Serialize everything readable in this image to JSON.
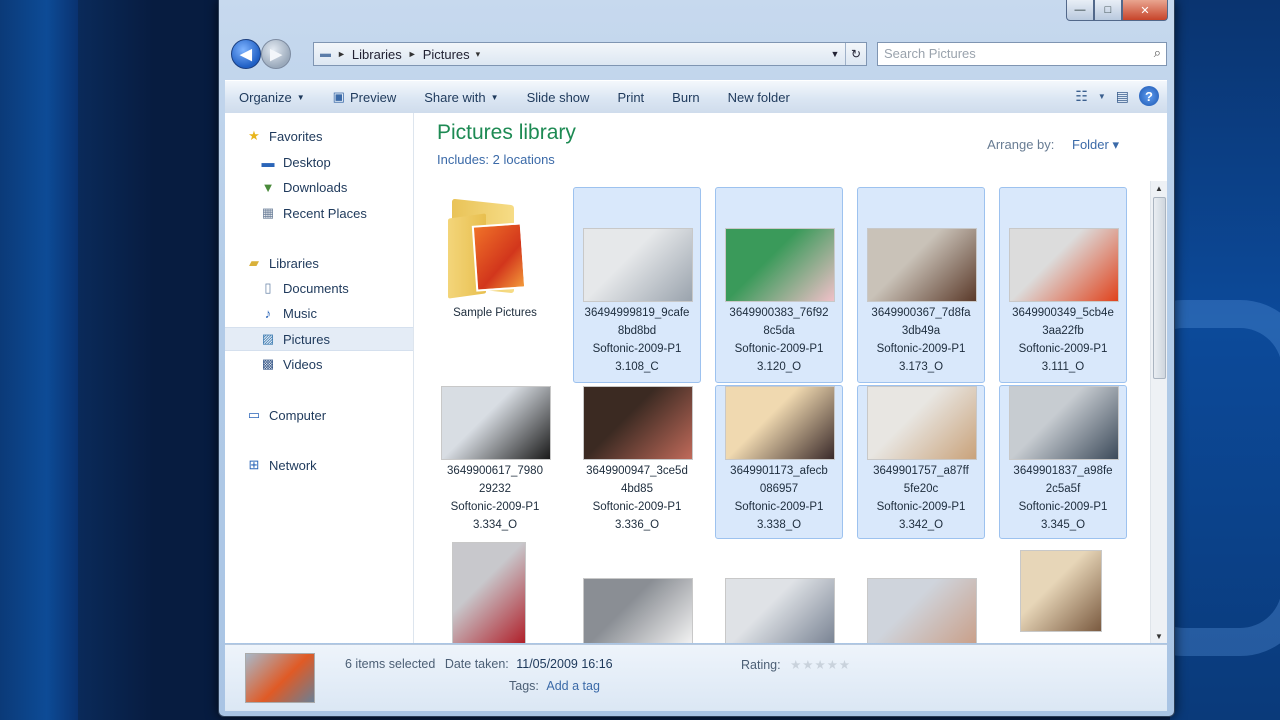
{
  "window": {
    "caption_minimize": "—",
    "caption_maximize": "□",
    "caption_close": "✕"
  },
  "address": {
    "crumbs": [
      "Libraries",
      "Pictures"
    ],
    "separator": "►"
  },
  "search": {
    "placeholder": "Search Pictures"
  },
  "toolbar": {
    "organize": "Organize",
    "preview": "Preview",
    "share_with": "Share with",
    "slide_show": "Slide show",
    "print": "Print",
    "burn": "Burn",
    "new_folder": "New folder",
    "help": "?"
  },
  "nav": {
    "favorites": "Favorites",
    "desktop": "Desktop",
    "downloads": "Downloads",
    "recent_places": "Recent Places",
    "libraries": "Libraries",
    "documents": "Documents",
    "music": "Music",
    "pictures": "Pictures",
    "videos": "Videos",
    "computer": "Computer",
    "network": "Network"
  },
  "library": {
    "title": "Pictures library",
    "subtitle": "Includes: 2 locations",
    "arrange_label": "Arrange by:",
    "arrange_value": "Folder ▾"
  },
  "items": [
    {
      "lines": [
        "Sample Pictures"
      ],
      "selected": false,
      "kind": "folder"
    },
    {
      "lines": [
        "36494999819_9cafe",
        "8bd8bd",
        "Softonic-2009-P1",
        "3.108_C"
      ],
      "selected": true,
      "colors": [
        "#e6e8ea",
        "#9aa3ad"
      ]
    },
    {
      "lines": [
        "3649900383_76f92",
        "8c5da",
        "Softonic-2009-P1",
        "3.120_O"
      ],
      "selected": true,
      "colors": [
        "#3a9a5a",
        "#f0c0c8"
      ]
    },
    {
      "lines": [
        "3649900367_7d8fa",
        "3db49a",
        "Softonic-2009-P1",
        "3.173_O"
      ],
      "selected": true,
      "colors": [
        "#c9c2b8",
        "#5b3a2a"
      ]
    },
    {
      "lines": [
        "3649900349_5cb4e",
        "3aa22fb",
        "Softonic-2009-P1",
        "3.111_O"
      ],
      "selected": true,
      "colors": [
        "#dcdcdc",
        "#e0421c"
      ]
    },
    {
      "lines": [
        "3649900617_7980",
        "29232",
        "Softonic-2009-P1",
        "3.334_O"
      ],
      "selected": false,
      "colors": [
        "#d8dde3",
        "#1a1a1a"
      ]
    },
    {
      "lines": [
        "3649900947_3ce5d",
        "4bd85",
        "Softonic-2009-P1",
        "3.336_O"
      ],
      "selected": false,
      "colors": [
        "#3b2a22",
        "#c06a5a"
      ]
    },
    {
      "lines": [
        "3649901173_afecb",
        "086957",
        "Softonic-2009-P1",
        "3.338_O"
      ],
      "selected": true,
      "colors": [
        "#f0d9b0",
        "#3a2a2a"
      ]
    },
    {
      "lines": [
        "3649901757_a87ff",
        "5fe20c",
        "Softonic-2009-P1",
        "3.342_O"
      ],
      "selected": true,
      "colors": [
        "#e8e6e2",
        "#c9a27a"
      ]
    },
    {
      "lines": [
        "3649901837_a98fe",
        "2c5a5f",
        "Softonic-2009-P1",
        "3.345_O"
      ],
      "selected": true,
      "colors": [
        "#c7ccd1",
        "#3c4a5a"
      ]
    },
    {
      "lines": [],
      "selected": false,
      "colors": [
        "#c8c8cc",
        "#b0202a"
      ]
    },
    {
      "lines": [],
      "selected": false,
      "colors": [
        "#8a8e94",
        "#f2f2f2"
      ]
    },
    {
      "lines": [],
      "selected": false,
      "colors": [
        "#dfe2e6",
        "#7a8494"
      ]
    },
    {
      "lines": [],
      "selected": false,
      "colors": [
        "#cfd4dc",
        "#c9a08a"
      ]
    },
    {
      "lines": [],
      "selected": false,
      "colors": [
        "#e7d6b8",
        "#7a5a40"
      ]
    }
  ],
  "details": {
    "selected_count": "6 items selected",
    "date_label": "Date taken:",
    "date_value": "11/05/2009 16:16",
    "rating_label": "Rating:",
    "stars": "★★★★★",
    "tags_label": "Tags:",
    "tags_value": "Add a tag"
  }
}
